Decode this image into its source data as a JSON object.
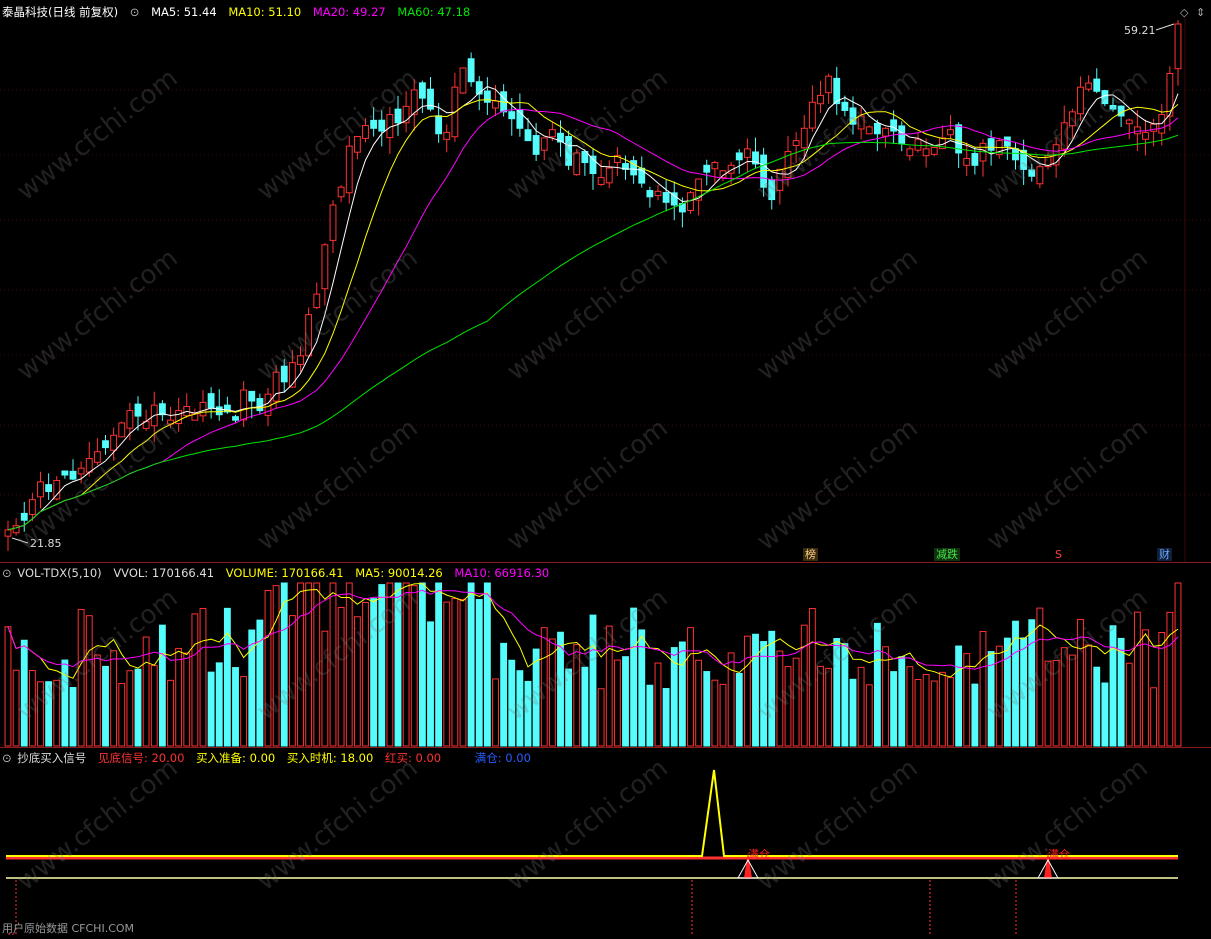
{
  "main_header": {
    "stock_name": "泰晶科技",
    "period": "(日线 前复权)",
    "ma5_label": "MA5: 51.44",
    "ma10_label": "MA10: 51.10",
    "ma20_label": "MA20: 49.27",
    "ma60_label": "MA60: 47.18"
  },
  "colors": {
    "up": "#ff3232",
    "down": "#54fcfc",
    "ma5": "#ffffff",
    "ma10": "#ffff00",
    "ma20": "#ff00ff",
    "ma60": "#00e600",
    "border": "#8b1a1a"
  },
  "price_labels": {
    "high": "59.21",
    "low": "21.85"
  },
  "event_flags": [
    {
      "text": "榜",
      "color": "#ffd080"
    },
    {
      "text": "减跌",
      "color": "#46e646"
    },
    {
      "text": "S",
      "color": "#ff4040"
    },
    {
      "text": "财",
      "color": "#6aa8ff"
    }
  ],
  "vol_header": {
    "name": "VOL-TDX(5,10)",
    "vvol": "VVOL: 170166.41",
    "volume": "VOLUME: 170166.41",
    "ma5": "MA5: 90014.26",
    "ma10": "MA10: 66916.30"
  },
  "signal_header": {
    "name": "抄底买入信号",
    "s1": "见底信号: 20.00",
    "s2": "买入准备: 0.00",
    "s3": "买入时机: 18.00",
    "s4": "红买: 0.00",
    "s5": "满仓: 0.00"
  },
  "signal_labels": [
    "满仓",
    "满仓"
  ],
  "footer_text": "用户原始数据 CFCHI.COM",
  "watermark": "www.cfchi.com",
  "chart_data": {
    "type": "candlestick",
    "title": "泰晶科技 (日线 前复权)",
    "price_range": [
      21.85,
      59.21
    ],
    "series": [
      {
        "name": "MA5",
        "value": 51.44
      },
      {
        "name": "MA10",
        "value": 51.1
      },
      {
        "name": "MA20",
        "value": 49.27
      },
      {
        "name": "MA60",
        "value": 47.18
      }
    ],
    "closes": [
      22.3,
      22.6,
      23.0,
      24.5,
      25.8,
      25.1,
      25.9,
      26.3,
      26.0,
      26.8,
      27.5,
      28.0,
      28.3,
      29.2,
      30.1,
      31.0,
      30.6,
      30.2,
      31.4,
      30.7,
      30.3,
      31.0,
      31.3,
      30.8,
      31.6,
      31.2,
      30.7,
      30.9,
      30.3,
      32.5,
      31.7,
      31.0,
      32.2,
      33.8,
      33.1,
      34.5,
      35.0,
      38.0,
      39.5,
      43.1,
      46.0,
      47.3,
      50.3,
      51.0,
      51.8,
      51.6,
      51.4,
      52.6,
      52.0,
      53.2,
      54.4,
      53.8,
      53.0,
      51.2,
      51.3,
      54.6,
      56.0,
      55.0,
      54.1,
      53.5,
      53.6,
      52.8,
      52.3,
      51.6,
      50.7,
      49.7,
      50.9,
      51.5,
      50.6,
      48.9,
      49.8,
      49.1,
      48.3,
      48.0,
      48.7,
      49.6,
      48.6,
      48.2,
      47.6,
      46.6,
      47.0,
      46.2,
      46.0,
      45.5,
      46.9,
      47.9,
      48.4,
      49.1,
      48.5,
      48.9,
      49.3,
      50.1,
      49.0,
      47.3,
      46.4,
      48.6,
      49.9,
      50.7,
      51.6,
      53.5,
      54.0,
      55.4,
      53.4,
      52.9,
      51.9,
      52.5,
      51.7,
      51.2,
      51.6,
      51.4,
      50.5,
      50.1,
      50.8,
      50.1,
      50.2,
      50.9,
      51.5,
      49.8,
      49.4,
      48.9,
      50.5,
      50.0,
      50.7,
      50.3,
      49.3,
      48.6,
      48.1,
      48.8,
      49.6,
      50.4,
      52.0,
      52.8,
      54.6,
      54.9,
      54.3,
      53.4,
      53.0,
      52.5,
      52.2,
      51.7,
      51.3,
      51.9,
      52.6,
      55.6,
      59.21
    ],
    "volume_last": 170166.41,
    "vol_ma5": 90014.26,
    "vol_ma10": 66916.3,
    "signals": {
      "见底信号": 20.0,
      "买入准备": 0.0,
      "买入时机": 18.0,
      "红买": 0.0,
      "满仓": 0.0
    }
  }
}
